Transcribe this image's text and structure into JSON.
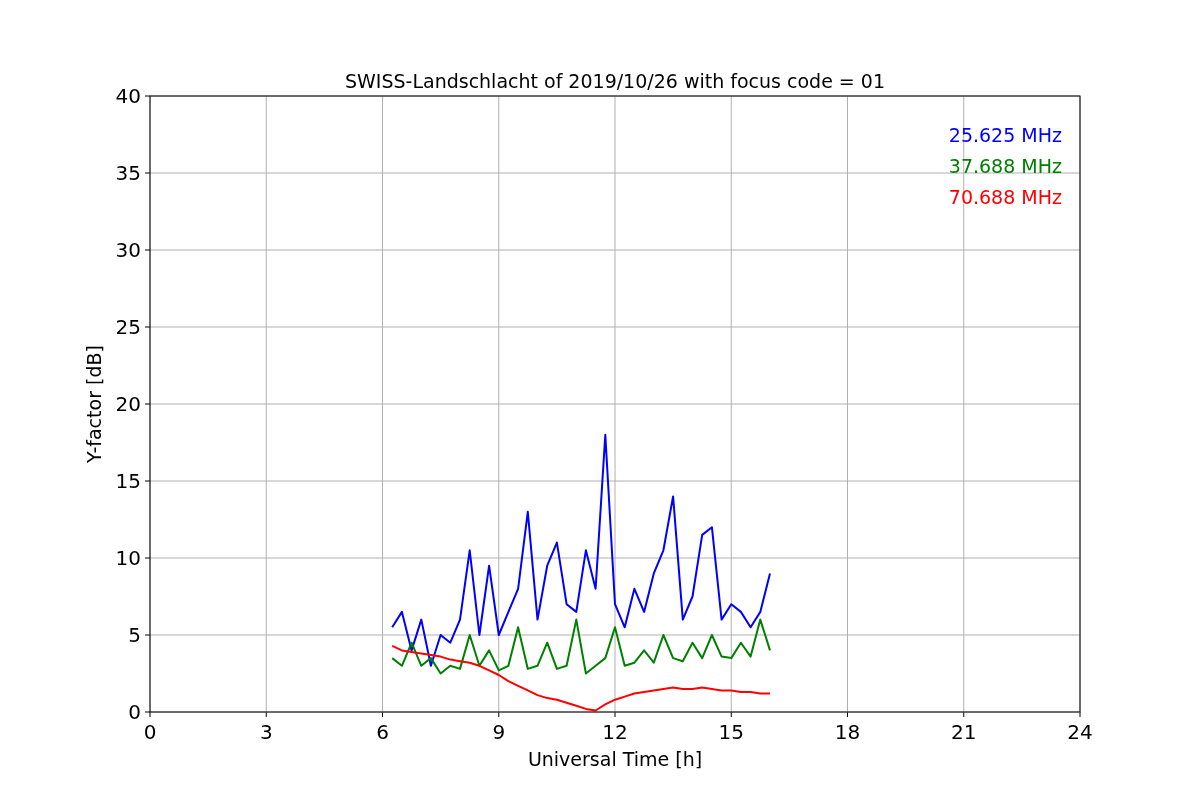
{
  "figure": {
    "chart_data": {
      "type": "line",
      "title": "SWISS-Landschlacht of 2019/10/26 with focus code = 01",
      "xlabel": "Universal Time [h]",
      "ylabel": "Y-factor [dB]",
      "x": [
        6.25,
        6.5,
        6.75,
        7.0,
        7.25,
        7.5,
        7.75,
        8.0,
        8.25,
        8.5,
        8.75,
        9.0,
        9.25,
        9.5,
        9.75,
        10.0,
        10.25,
        10.5,
        10.75,
        11.0,
        11.25,
        11.5,
        11.75,
        12.0,
        12.25,
        12.5,
        12.75,
        13.0,
        13.25,
        13.5,
        13.75,
        14.0,
        14.25,
        14.5,
        14.75,
        15.0,
        15.25,
        15.5,
        15.75,
        16.0
      ],
      "series": [
        {
          "name": "25.625 MHz",
          "color": "#0000ff",
          "values": [
            5.5,
            6.5,
            4.0,
            6.0,
            3.0,
            5.0,
            4.5,
            6.0,
            10.5,
            5.0,
            9.5,
            5.0,
            6.5,
            8.0,
            13.0,
            6.0,
            9.5,
            11.0,
            7.0,
            6.5,
            10.5,
            8.0,
            18.0,
            7.0,
            5.5,
            8.0,
            6.5,
            9.0,
            10.5,
            14.0,
            6.0,
            7.5,
            11.5,
            12.0,
            6.0,
            7.0,
            6.5,
            5.5,
            6.5,
            9.0
          ]
        },
        {
          "name": "37.688 MHz",
          "color": "#008000",
          "values": [
            3.5,
            3.0,
            4.5,
            3.0,
            3.5,
            2.5,
            3.0,
            2.8,
            5.0,
            3.0,
            4.0,
            2.7,
            3.0,
            5.5,
            2.8,
            3.0,
            4.5,
            2.8,
            3.0,
            6.0,
            2.5,
            3.0,
            3.5,
            5.5,
            3.0,
            3.2,
            4.0,
            3.2,
            5.0,
            3.5,
            3.3,
            4.5,
            3.5,
            5.0,
            3.6,
            3.5,
            4.5,
            3.6,
            6.0,
            4.0
          ]
        },
        {
          "name": "70.688 MHz",
          "color": "#ff0000",
          "values": [
            4.3,
            4.0,
            3.9,
            3.8,
            3.7,
            3.6,
            3.4,
            3.3,
            3.2,
            3.0,
            2.7,
            2.4,
            2.0,
            1.7,
            1.4,
            1.1,
            0.9,
            0.8,
            0.6,
            0.4,
            0.2,
            0.1,
            0.5,
            0.8,
            1.0,
            1.2,
            1.3,
            1.4,
            1.5,
            1.6,
            1.5,
            1.5,
            1.6,
            1.5,
            1.4,
            1.4,
            1.3,
            1.3,
            1.2,
            1.2
          ]
        }
      ],
      "xlim": [
        0,
        24
      ],
      "ylim": [
        0,
        40
      ],
      "xticks": [
        0,
        3,
        6,
        9,
        12,
        15,
        18,
        21,
        24
      ],
      "yticks": [
        0,
        5,
        10,
        15,
        20,
        25,
        30,
        35,
        40
      ],
      "grid": true
    }
  }
}
